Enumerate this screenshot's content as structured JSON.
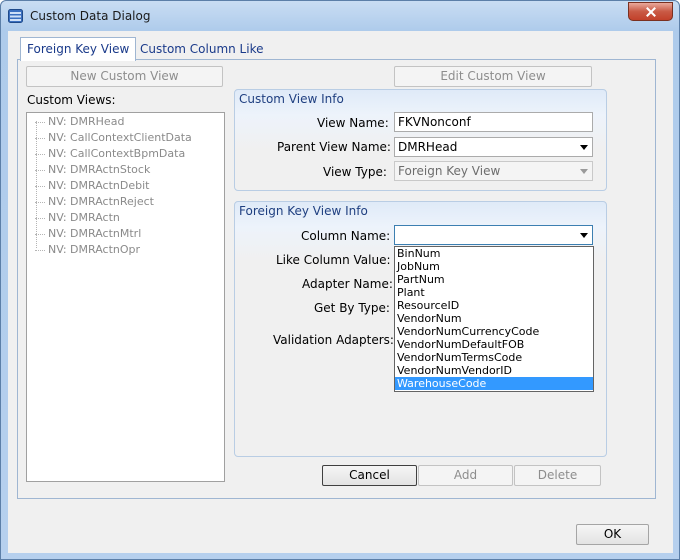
{
  "window": {
    "title": "Custom Data Dialog"
  },
  "tabs": [
    {
      "label": "Foreign Key View"
    },
    {
      "label": "Custom Column Like"
    }
  ],
  "buttons": {
    "new_custom_view": "New Custom View",
    "edit_custom_view": "Edit Custom View",
    "cancel": "Cancel",
    "add": "Add",
    "delete": "Delete",
    "ok": "OK"
  },
  "custom_views": {
    "label": "Custom Views:",
    "items": [
      "NV: DMRHead",
      "NV: CallContextClientData",
      "NV: CallContextBpmData",
      "NV: DMRActnStock",
      "NV: DMRActnDebit",
      "NV: DMRActnReject",
      "NV: DMRActn",
      "NV: DMRActnMtrl",
      "NV: DMRActnOpr"
    ]
  },
  "custom_view_info": {
    "title": "Custom View Info",
    "view_name_label": "View Name:",
    "view_name_value": "FKVNonconf",
    "parent_view_label": "Parent View Name:",
    "parent_view_value": "DMRHead",
    "view_type_label": "View Type:",
    "view_type_value": "Foreign Key View"
  },
  "fk_view_info": {
    "title": "Foreign Key View Info",
    "column_name_label": "Column Name:",
    "column_name_value": "",
    "like_column_label": "Like Column Value:",
    "adapter_name_label": "Adapter Name:",
    "get_by_type_label": "Get By Type:",
    "validation_adapters_label": "Validation Adapters:"
  },
  "column_dropdown": {
    "options": [
      "BinNum",
      "JobNum",
      "PartNum",
      "Plant",
      "ResourceID",
      "VendorNum",
      "VendorNumCurrencyCode",
      "VendorNumDefaultFOB",
      "VendorNumTermsCode",
      "VendorNumVendorID",
      "WarehouseCode"
    ],
    "selected": "WarehouseCode"
  },
  "colors": {
    "accent": "#1f3f80",
    "selection": "#3399ff"
  }
}
